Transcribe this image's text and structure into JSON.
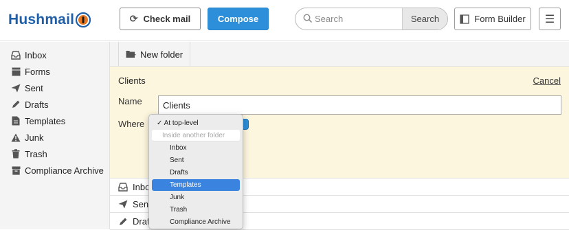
{
  "logo": {
    "part1": "Hush",
    "part2": "mail"
  },
  "header": {
    "check_mail": "Check mail",
    "compose": "Compose",
    "search_placeholder": "Search",
    "search_button": "Search",
    "form_builder": "Form Builder",
    "menu_icon": "☰"
  },
  "sidebar": {
    "items": [
      {
        "label": "Inbox",
        "icon": "inbox-icon"
      },
      {
        "label": "Forms",
        "icon": "forms-icon"
      },
      {
        "label": "Sent",
        "icon": "sent-icon"
      },
      {
        "label": "Drafts",
        "icon": "drafts-icon"
      },
      {
        "label": "Templates",
        "icon": "templates-icon"
      },
      {
        "label": "Junk",
        "icon": "junk-icon"
      },
      {
        "label": "Trash",
        "icon": "trash-icon"
      },
      {
        "label": "Compliance Archive",
        "icon": "archive-icon"
      }
    ]
  },
  "toolbar": {
    "new_folder": "New folder"
  },
  "panel": {
    "title": "Clients",
    "cancel": "Cancel",
    "name_label": "Name",
    "name_value": "Clients",
    "where_label": "Where"
  },
  "rows": [
    {
      "label": "Inbox",
      "icon": "inbox-icon"
    },
    {
      "label": "Sent",
      "icon": "sent-icon"
    },
    {
      "label": "Drafts",
      "icon": "drafts-icon"
    }
  ],
  "dropdown": {
    "options": [
      {
        "label": "✓ At top-level",
        "kind": "top"
      },
      {
        "label": "Inside another folder",
        "kind": "header"
      },
      {
        "label": "Inbox",
        "kind": "item"
      },
      {
        "label": "Sent",
        "kind": "item"
      },
      {
        "label": "Drafts",
        "kind": "item"
      },
      {
        "label": "Templates",
        "kind": "selected"
      },
      {
        "label": "Junk",
        "kind": "item"
      },
      {
        "label": "Trash",
        "kind": "item"
      },
      {
        "label": "Compliance Archive",
        "kind": "item"
      }
    ]
  },
  "colors": {
    "brand": "#1f5fa8",
    "accent": "#2d8fd9",
    "panel_bg": "#fdf6de",
    "selected": "#3a84e0"
  }
}
